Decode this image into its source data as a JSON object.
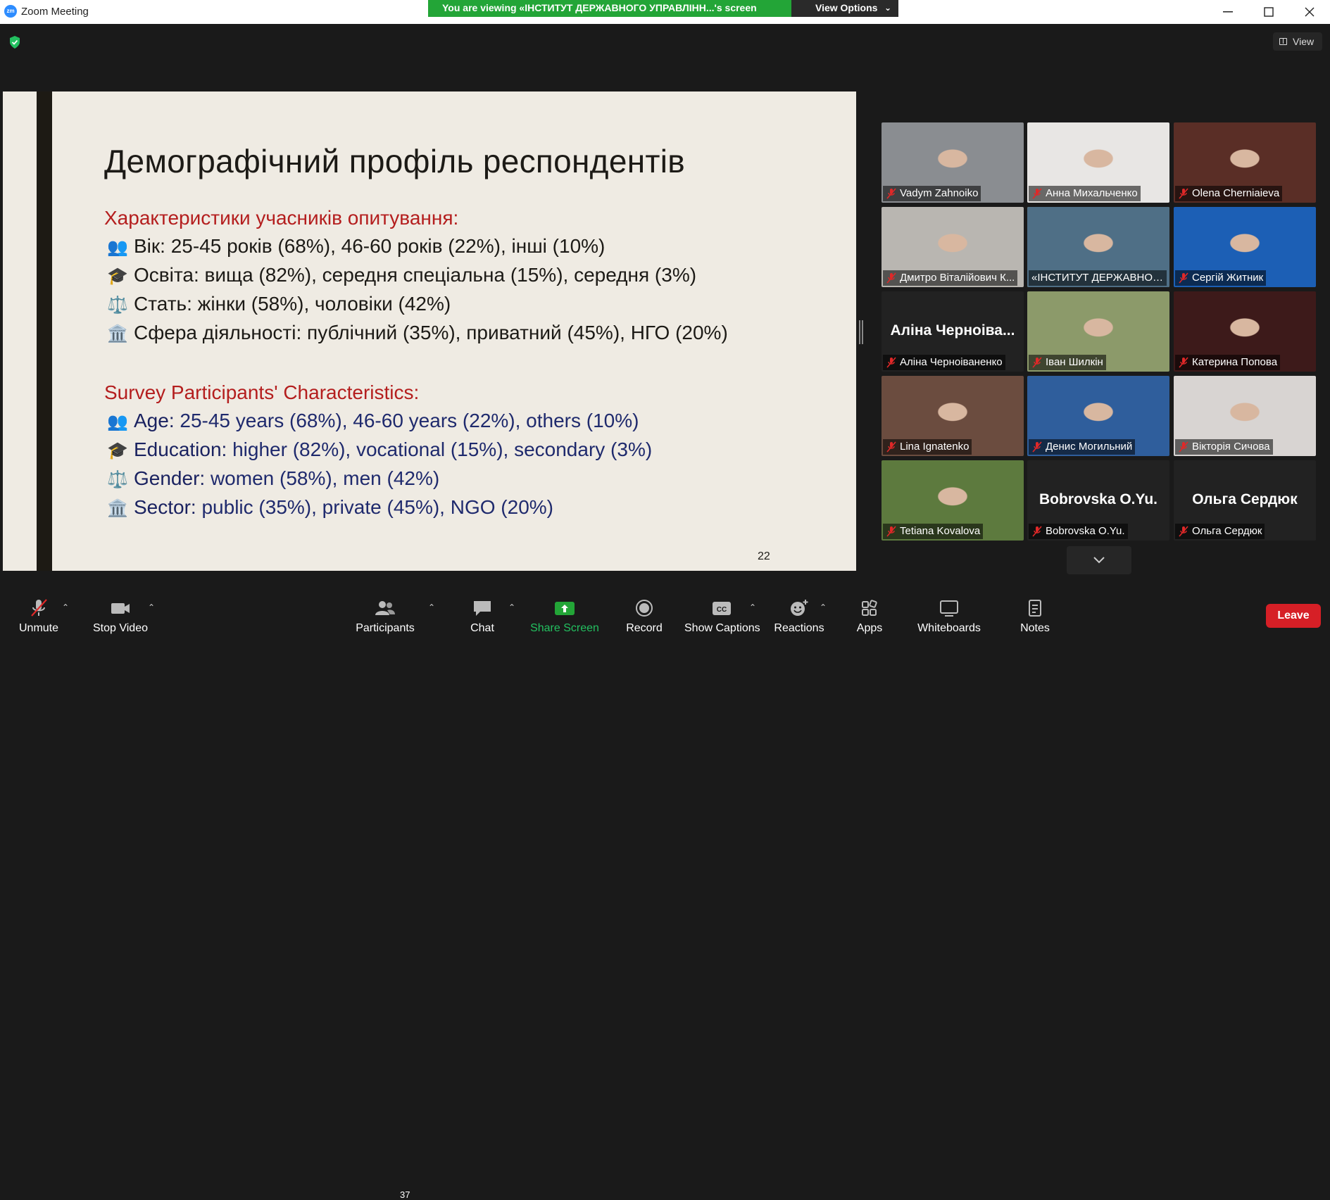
{
  "window": {
    "title": "Zoom Meeting",
    "logo": "zm"
  },
  "share_banner": {
    "text": "You are viewing «ІНСТИТУТ ДЕРЖАВНОГО УПРАВЛІНН...'s screen",
    "view_options": "View Options"
  },
  "view_button": {
    "label": "View"
  },
  "slide": {
    "title": "Демографічний профіль респондентів",
    "ua_heading": "Характеристики учасників опитування:",
    "ua_items": [
      {
        "icon": "👥",
        "key": "Вік:",
        "value": " 25-45 років (68%), 46-60 років (22%), інші (10%)"
      },
      {
        "icon": "🎓",
        "key": "Освіта:",
        "value": " вища (82%), середня спеціальна (15%), середня (3%)"
      },
      {
        "icon": "⚖️",
        "key": "Стать:",
        "value": " жінки (58%), чоловіки (42%)"
      },
      {
        "icon": "🏛️",
        "key": "Сфера діяльності:",
        "value": " публічний (35%), приватний (45%), НГО (20%)"
      }
    ],
    "en_heading": "Survey Participants' Characteristics:",
    "en_items": [
      {
        "icon": "👥",
        "key": "Age:",
        "value": " 25-45 years (68%), 46-60 years (22%), others (10%)"
      },
      {
        "icon": "🎓",
        "key": "Education:",
        "value": " higher (82%), vocational (15%), secondary (3%)"
      },
      {
        "icon": "⚖️",
        "key": "Gender:",
        "value": " women (58%), men (42%)"
      },
      {
        "icon": "🏛️",
        "key": "Sector:",
        "value": " public (35%), private (45%), NGO (20%)"
      }
    ],
    "page_number": "22"
  },
  "participants": [
    {
      "name": "Vadym Zahnoiko",
      "muted": true,
      "video": true,
      "bg": "#8a8d91"
    },
    {
      "name": "Анна Михальченко",
      "muted": true,
      "video": true,
      "bg": "#e8e6e4"
    },
    {
      "name": "Olena Cherniaieva",
      "muted": true,
      "video": true,
      "bg": "#5a2e26"
    },
    {
      "name": "Дмитро Віталійович К...",
      "muted": true,
      "video": true,
      "bg": "#b9b6b1"
    },
    {
      "name": "«ІНСТИТУТ ДЕРЖАВНОГ...",
      "muted": false,
      "video": true,
      "bg": "#4f6f86",
      "speaking": true
    },
    {
      "name": "Сергій Житник",
      "muted": true,
      "video": true,
      "bg": "#1c5fb5"
    },
    {
      "name": "Аліна Черноіваненко",
      "big_name": "Аліна Черноіва...",
      "muted": true,
      "video": false
    },
    {
      "name": "Іван Шилкін",
      "muted": true,
      "video": true,
      "bg": "#8c9a6a"
    },
    {
      "name": "Катерина Попова",
      "muted": true,
      "video": true,
      "bg": "#3d1a1a"
    },
    {
      "name": "Lina Ignatenko",
      "muted": true,
      "video": true,
      "bg": "#6b4c3f"
    },
    {
      "name": "Денис Могильний",
      "muted": true,
      "video": true,
      "bg": "#2f5e9c"
    },
    {
      "name": "Вікторія Сичова",
      "muted": true,
      "video": true,
      "bg": "#d8d4d2"
    },
    {
      "name": "Tetiana Kovalova",
      "muted": true,
      "video": true,
      "bg": "#5d7a3e"
    },
    {
      "name": "Bobrovska O.Yu.",
      "big_name": "Bobrovska O.Yu.",
      "muted": true,
      "video": false
    },
    {
      "name": "Ольга Сердюк",
      "big_name": "Ольга Сердюк",
      "muted": true,
      "video": false
    }
  ],
  "toolbar": {
    "unmute": "Unmute",
    "stop_video": "Stop Video",
    "participants": "Participants",
    "participants_count": "37",
    "chat": "Chat",
    "share_screen": "Share Screen",
    "record": "Record",
    "show_captions": "Show Captions",
    "reactions": "Reactions",
    "apps": "Apps",
    "whiteboards": "Whiteboards",
    "notes": "Notes",
    "leave": "Leave"
  },
  "colors": {
    "accent_green": "#23a537",
    "leave_red": "#d61f26",
    "slide_red": "#b41e1e",
    "slide_navy": "#1f2a6d",
    "speaker_outline": "#e3e86a"
  }
}
